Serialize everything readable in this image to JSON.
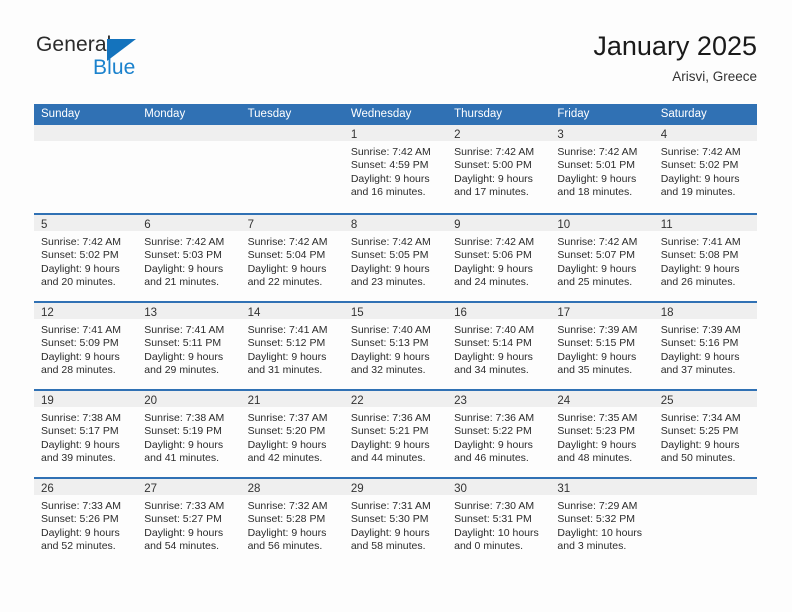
{
  "brand": {
    "word1": "General",
    "word2": "Blue",
    "triangle_color": "#1473bd",
    "blue_color": "#1b82cd"
  },
  "header": {
    "title": "January 2025",
    "subtitle": "Arisvi, Greece"
  },
  "theme": {
    "header_blue": "#3071b4",
    "day_band_gray": "#efefef",
    "page_background": "#fdfdfd"
  },
  "weekdays": [
    "Sunday",
    "Monday",
    "Tuesday",
    "Wednesday",
    "Thursday",
    "Friday",
    "Saturday"
  ],
  "labels": {
    "sunrise_prefix": "Sunrise:",
    "sunset_prefix": "Sunset:",
    "daylight_prefix": "Daylight:"
  },
  "weeks": [
    [
      {
        "day": "",
        "lines": [
          "",
          "",
          "",
          ""
        ]
      },
      {
        "day": "",
        "lines": [
          "",
          "",
          "",
          ""
        ]
      },
      {
        "day": "",
        "lines": [
          "",
          "",
          "",
          ""
        ]
      },
      {
        "day": "1",
        "lines": [
          "Sunrise: 7:42 AM",
          "Sunset: 4:59 PM",
          "Daylight: 9 hours",
          "and 16 minutes."
        ]
      },
      {
        "day": "2",
        "lines": [
          "Sunrise: 7:42 AM",
          "Sunset: 5:00 PM",
          "Daylight: 9 hours",
          "and 17 minutes."
        ]
      },
      {
        "day": "3",
        "lines": [
          "Sunrise: 7:42 AM",
          "Sunset: 5:01 PM",
          "Daylight: 9 hours",
          "and 18 minutes."
        ]
      },
      {
        "day": "4",
        "lines": [
          "Sunrise: 7:42 AM",
          "Sunset: 5:02 PM",
          "Daylight: 9 hours",
          "and 19 minutes."
        ]
      }
    ],
    [
      {
        "day": "5",
        "lines": [
          "Sunrise: 7:42 AM",
          "Sunset: 5:02 PM",
          "Daylight: 9 hours",
          "and 20 minutes."
        ]
      },
      {
        "day": "6",
        "lines": [
          "Sunrise: 7:42 AM",
          "Sunset: 5:03 PM",
          "Daylight: 9 hours",
          "and 21 minutes."
        ]
      },
      {
        "day": "7",
        "lines": [
          "Sunrise: 7:42 AM",
          "Sunset: 5:04 PM",
          "Daylight: 9 hours",
          "and 22 minutes."
        ]
      },
      {
        "day": "8",
        "lines": [
          "Sunrise: 7:42 AM",
          "Sunset: 5:05 PM",
          "Daylight: 9 hours",
          "and 23 minutes."
        ]
      },
      {
        "day": "9",
        "lines": [
          "Sunrise: 7:42 AM",
          "Sunset: 5:06 PM",
          "Daylight: 9 hours",
          "and 24 minutes."
        ]
      },
      {
        "day": "10",
        "lines": [
          "Sunrise: 7:42 AM",
          "Sunset: 5:07 PM",
          "Daylight: 9 hours",
          "and 25 minutes."
        ]
      },
      {
        "day": "11",
        "lines": [
          "Sunrise: 7:41 AM",
          "Sunset: 5:08 PM",
          "Daylight: 9 hours",
          "and 26 minutes."
        ]
      }
    ],
    [
      {
        "day": "12",
        "lines": [
          "Sunrise: 7:41 AM",
          "Sunset: 5:09 PM",
          "Daylight: 9 hours",
          "and 28 minutes."
        ]
      },
      {
        "day": "13",
        "lines": [
          "Sunrise: 7:41 AM",
          "Sunset: 5:11 PM",
          "Daylight: 9 hours",
          "and 29 minutes."
        ]
      },
      {
        "day": "14",
        "lines": [
          "Sunrise: 7:41 AM",
          "Sunset: 5:12 PM",
          "Daylight: 9 hours",
          "and 31 minutes."
        ]
      },
      {
        "day": "15",
        "lines": [
          "Sunrise: 7:40 AM",
          "Sunset: 5:13 PM",
          "Daylight: 9 hours",
          "and 32 minutes."
        ]
      },
      {
        "day": "16",
        "lines": [
          "Sunrise: 7:40 AM",
          "Sunset: 5:14 PM",
          "Daylight: 9 hours",
          "and 34 minutes."
        ]
      },
      {
        "day": "17",
        "lines": [
          "Sunrise: 7:39 AM",
          "Sunset: 5:15 PM",
          "Daylight: 9 hours",
          "and 35 minutes."
        ]
      },
      {
        "day": "18",
        "lines": [
          "Sunrise: 7:39 AM",
          "Sunset: 5:16 PM",
          "Daylight: 9 hours",
          "and 37 minutes."
        ]
      }
    ],
    [
      {
        "day": "19",
        "lines": [
          "Sunrise: 7:38 AM",
          "Sunset: 5:17 PM",
          "Daylight: 9 hours",
          "and 39 minutes."
        ]
      },
      {
        "day": "20",
        "lines": [
          "Sunrise: 7:38 AM",
          "Sunset: 5:19 PM",
          "Daylight: 9 hours",
          "and 41 minutes."
        ]
      },
      {
        "day": "21",
        "lines": [
          "Sunrise: 7:37 AM",
          "Sunset: 5:20 PM",
          "Daylight: 9 hours",
          "and 42 minutes."
        ]
      },
      {
        "day": "22",
        "lines": [
          "Sunrise: 7:36 AM",
          "Sunset: 5:21 PM",
          "Daylight: 9 hours",
          "and 44 minutes."
        ]
      },
      {
        "day": "23",
        "lines": [
          "Sunrise: 7:36 AM",
          "Sunset: 5:22 PM",
          "Daylight: 9 hours",
          "and 46 minutes."
        ]
      },
      {
        "day": "24",
        "lines": [
          "Sunrise: 7:35 AM",
          "Sunset: 5:23 PM",
          "Daylight: 9 hours",
          "and 48 minutes."
        ]
      },
      {
        "day": "25",
        "lines": [
          "Sunrise: 7:34 AM",
          "Sunset: 5:25 PM",
          "Daylight: 9 hours",
          "and 50 minutes."
        ]
      }
    ],
    [
      {
        "day": "26",
        "lines": [
          "Sunrise: 7:33 AM",
          "Sunset: 5:26 PM",
          "Daylight: 9 hours",
          "and 52 minutes."
        ]
      },
      {
        "day": "27",
        "lines": [
          "Sunrise: 7:33 AM",
          "Sunset: 5:27 PM",
          "Daylight: 9 hours",
          "and 54 minutes."
        ]
      },
      {
        "day": "28",
        "lines": [
          "Sunrise: 7:32 AM",
          "Sunset: 5:28 PM",
          "Daylight: 9 hours",
          "and 56 minutes."
        ]
      },
      {
        "day": "29",
        "lines": [
          "Sunrise: 7:31 AM",
          "Sunset: 5:30 PM",
          "Daylight: 9 hours",
          "and 58 minutes."
        ]
      },
      {
        "day": "30",
        "lines": [
          "Sunrise: 7:30 AM",
          "Sunset: 5:31 PM",
          "Daylight: 10 hours",
          "and 0 minutes."
        ]
      },
      {
        "day": "31",
        "lines": [
          "Sunrise: 7:29 AM",
          "Sunset: 5:32 PM",
          "Daylight: 10 hours",
          "and 3 minutes."
        ]
      },
      {
        "day": "",
        "lines": [
          "",
          "",
          "",
          ""
        ]
      }
    ]
  ]
}
